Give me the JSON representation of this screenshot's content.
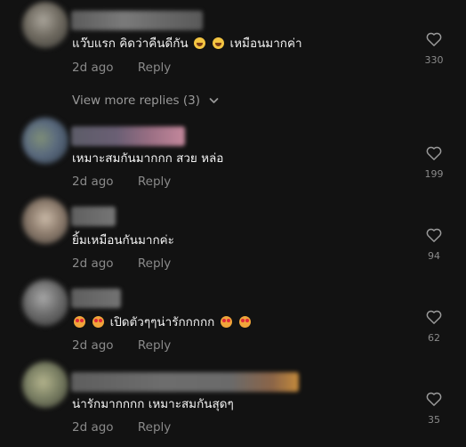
{
  "colors": {
    "background": "#121212",
    "text": "#f2f2f2",
    "muted": "#8a8a8a"
  },
  "view_more_replies": "View more replies (3)",
  "comments": [
    {
      "text_before": "แว๊บแรก คิดว่าคืนดีกัน",
      "emojis_mid": [
        "grinning-squinting-face",
        "grinning-squinting-face"
      ],
      "text_after": " เหมือนมากค่า",
      "time": "2d ago",
      "reply": "Reply",
      "likes": "330"
    },
    {
      "text": "เหมาะสมกันมากกก สวย หล่อ",
      "time": "2d ago",
      "reply": "Reply",
      "likes": "199"
    },
    {
      "text": "ยิ้มเหมือนกันมากค่ะ",
      "time": "2d ago",
      "reply": "Reply",
      "likes": "94"
    },
    {
      "emojis_pre": [
        "smiling-face-with-hearts",
        "smiling-face-with-hearts"
      ],
      "text": " เปิดตัวๆๆน่ารักกกกก",
      "emojis_post": [
        "smiling-face-with-hearts",
        "smiling-face-with-hearts"
      ],
      "time": "2d ago",
      "reply": "Reply",
      "likes": "62"
    },
    {
      "text": "น่ารักมากกกก เหมาะสมกันสุดๆ",
      "time": "2d ago",
      "reply": "Reply",
      "likes": "35"
    }
  ]
}
